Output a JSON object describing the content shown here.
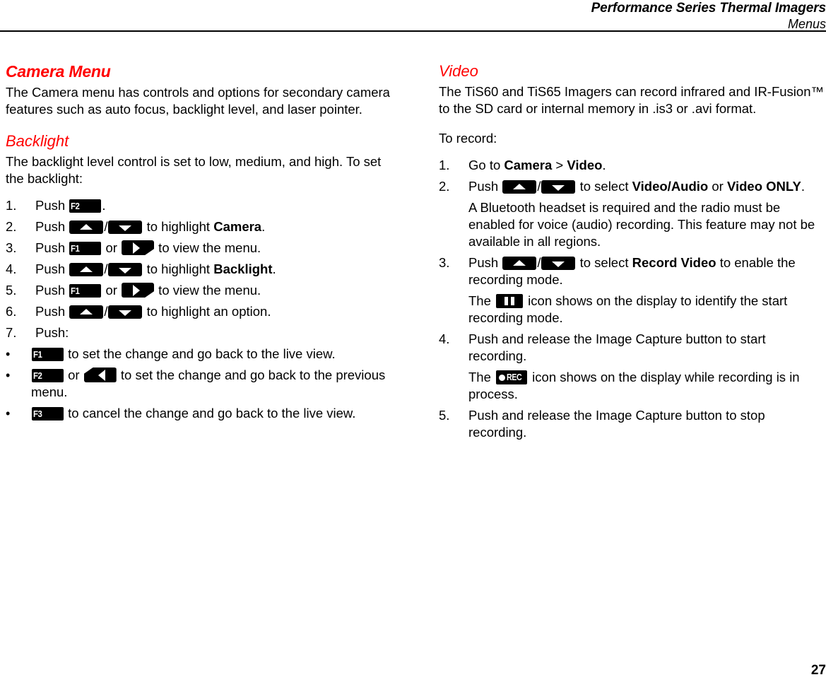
{
  "header": {
    "title": "Performance Series Thermal Imagers",
    "subtitle": "Menus"
  },
  "footer": {
    "page_number": "27"
  },
  "colors": {
    "heading": "#ff0000",
    "text": "#000000",
    "key_background": "#000000",
    "key_foreground": "#ffffff"
  },
  "left_column": {
    "heading": "Camera Menu",
    "intro": "The Camera menu has controls and options for secondary camera features such as auto focus, backlight level, and laser pointer.",
    "subheading": "Backlight",
    "subintro": "The backlight level control is set to low, medium, and high. To set the backlight:",
    "steps": [
      {
        "number": "1.",
        "parts": [
          {
            "type": "text",
            "value": "Push "
          },
          {
            "type": "key",
            "icon": "key-f2",
            "label": "F2"
          },
          {
            "type": "text",
            "value": "."
          }
        ]
      },
      {
        "number": "2.",
        "parts": [
          {
            "type": "text",
            "value": "Push "
          },
          {
            "type": "key",
            "icon": "key-up-arrow",
            "label": ""
          },
          {
            "type": "text",
            "value": "/"
          },
          {
            "type": "key",
            "icon": "key-down-arrow",
            "label": ""
          },
          {
            "type": "text",
            "value": " to highlight "
          },
          {
            "type": "bold",
            "value": "Camera"
          },
          {
            "type": "text",
            "value": "."
          }
        ]
      },
      {
        "number": "3.",
        "parts": [
          {
            "type": "text",
            "value": "Push "
          },
          {
            "type": "key",
            "icon": "key-f1",
            "label": "F1"
          },
          {
            "type": "text",
            "value": " or "
          },
          {
            "type": "key",
            "icon": "key-right-arrow",
            "label": ""
          },
          {
            "type": "text",
            "value": " to view the menu."
          }
        ]
      },
      {
        "number": "4.",
        "parts": [
          {
            "type": "text",
            "value": "Push "
          },
          {
            "type": "key",
            "icon": "key-up-arrow",
            "label": ""
          },
          {
            "type": "text",
            "value": "/"
          },
          {
            "type": "key",
            "icon": "key-down-arrow",
            "label": ""
          },
          {
            "type": "text",
            "value": " to highlight "
          },
          {
            "type": "bold",
            "value": "Backlight"
          },
          {
            "type": "text",
            "value": "."
          }
        ]
      },
      {
        "number": "5.",
        "parts": [
          {
            "type": "text",
            "value": "Push "
          },
          {
            "type": "key",
            "icon": "key-f1",
            "label": "F1"
          },
          {
            "type": "text",
            "value": " or "
          },
          {
            "type": "key",
            "icon": "key-right-arrow",
            "label": ""
          },
          {
            "type": "text",
            "value": " to view the menu."
          }
        ]
      },
      {
        "number": "6.",
        "parts": [
          {
            "type": "text",
            "value": "Push "
          },
          {
            "type": "key",
            "icon": "key-up-arrow",
            "label": ""
          },
          {
            "type": "text",
            "value": "/"
          },
          {
            "type": "key",
            "icon": "key-down-arrow",
            "label": ""
          },
          {
            "type": "text",
            "value": " to highlight an option."
          }
        ]
      },
      {
        "number": "7.",
        "parts": [
          {
            "type": "text",
            "value": "Push:"
          }
        ]
      }
    ],
    "bullets": [
      {
        "marker": "•",
        "parts": [
          {
            "type": "key",
            "icon": "key-f1",
            "label": "F1"
          },
          {
            "type": "text",
            "value": " to set the change and go back to the live view."
          }
        ]
      },
      {
        "marker": "•",
        "parts": [
          {
            "type": "key",
            "icon": "key-f2",
            "label": "F2"
          },
          {
            "type": "text",
            "value": " or "
          },
          {
            "type": "key",
            "icon": "key-left-arrow",
            "label": ""
          },
          {
            "type": "text",
            "value": " to set the change and go back to the previous menu."
          }
        ]
      },
      {
        "marker": "•",
        "parts": [
          {
            "type": "key",
            "icon": "key-f3",
            "label": "F3"
          },
          {
            "type": "text",
            "value": " to cancel the change and go back to the live view."
          }
        ]
      }
    ]
  },
  "right_column": {
    "heading": "Video",
    "intro": "The TiS60 and TiS65 Imagers can record infrared and IR-Fusion™ to the SD card or internal memory in .is3 or .avi format.",
    "lead_in": "To record:",
    "steps": [
      {
        "number": "1.",
        "parts": [
          {
            "type": "text",
            "value": "Go to "
          },
          {
            "type": "bold",
            "value": "Camera"
          },
          {
            "type": "text",
            "value": " > "
          },
          {
            "type": "bold",
            "value": "Video"
          },
          {
            "type": "text",
            "value": "."
          }
        ]
      },
      {
        "number": "2.",
        "parts": [
          {
            "type": "text",
            "value": "Push "
          },
          {
            "type": "key",
            "icon": "key-up-arrow",
            "label": ""
          },
          {
            "type": "text",
            "value": "/"
          },
          {
            "type": "key",
            "icon": "key-down-arrow",
            "label": ""
          },
          {
            "type": "text",
            "value": " to select "
          },
          {
            "type": "bold",
            "value": "Video/Audio"
          },
          {
            "type": "text",
            "value": " or "
          },
          {
            "type": "bold",
            "value": "Video ONLY"
          },
          {
            "type": "text",
            "value": "."
          }
        ],
        "note": "A Bluetooth headset is required and the radio must be enabled for voice (audio) recording. This feature may not be available in all regions."
      },
      {
        "number": "3.",
        "parts": [
          {
            "type": "text",
            "value": "Push "
          },
          {
            "type": "key",
            "icon": "key-up-arrow",
            "label": ""
          },
          {
            "type": "text",
            "value": "/"
          },
          {
            "type": "key",
            "icon": "key-down-arrow",
            "label": ""
          },
          {
            "type": "text",
            "value": " to select "
          },
          {
            "type": "bold",
            "value": "Record Video"
          },
          {
            "type": "text",
            "value": " to enable the recording mode."
          }
        ],
        "note_parts": [
          {
            "type": "text",
            "value": "The "
          },
          {
            "type": "key",
            "icon": "pause-icon",
            "label": ""
          },
          {
            "type": "text",
            "value": " icon shows on the display to identify the start recording mode."
          }
        ]
      },
      {
        "number": "4.",
        "parts": [
          {
            "type": "text",
            "value": "Push and release the Image Capture button to start recording."
          }
        ],
        "note_parts": [
          {
            "type": "text",
            "value": "The "
          },
          {
            "type": "key",
            "icon": "record-icon",
            "label": "REC"
          },
          {
            "type": "text",
            "value": " icon shows on the display while recording is in process."
          }
        ]
      },
      {
        "number": "5.",
        "parts": [
          {
            "type": "text",
            "value": "Push and release the Image Capture button to stop recording."
          }
        ]
      }
    ]
  }
}
